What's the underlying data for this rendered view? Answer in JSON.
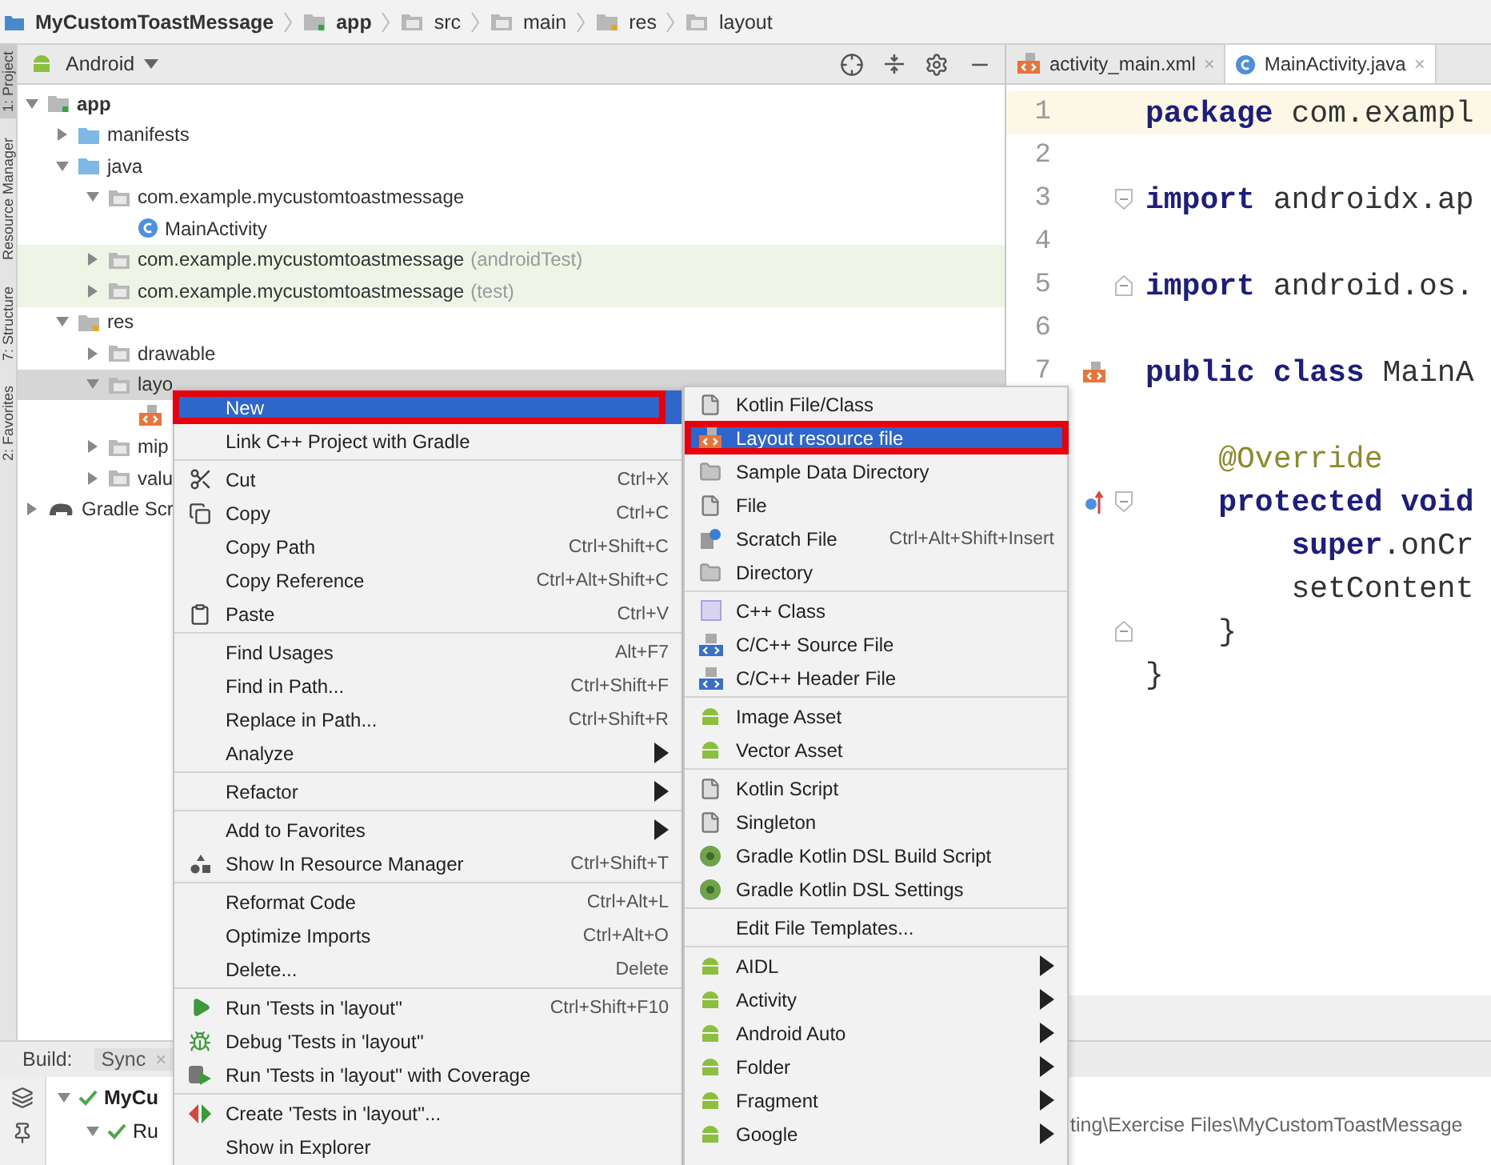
{
  "breadcrumb": [
    {
      "label": "MyCustomToastMessage",
      "bold": true,
      "kind": "project"
    },
    {
      "label": "app",
      "bold": true,
      "kind": "module"
    },
    {
      "label": "src",
      "bold": false,
      "kind": "folder"
    },
    {
      "label": "main",
      "bold": false,
      "kind": "folder"
    },
    {
      "label": "res",
      "bold": false,
      "kind": "res"
    },
    {
      "label": "layout",
      "bold": false,
      "kind": "folder"
    }
  ],
  "side_tabs": [
    {
      "label": "1: Project",
      "selected": true
    },
    {
      "label": "Resource Manager",
      "selected": false
    },
    {
      "label": "7: Structure",
      "selected": false
    },
    {
      "label": "2: Favorites",
      "selected": false
    }
  ],
  "project": {
    "view": "Android",
    "tree": [
      {
        "label": "app",
        "bold": true,
        "kind": "module",
        "expanded": true,
        "selected": false,
        "tinted": false,
        "children": [
          {
            "label": "manifests",
            "bold": false,
            "kind": "source",
            "expanded": false,
            "selected": false,
            "tinted": false
          },
          {
            "label": "java",
            "bold": false,
            "kind": "source",
            "expanded": true,
            "selected": false,
            "tinted": false,
            "children": [
              {
                "label": "com.example.mycustomtoastmessage",
                "bold": false,
                "kind": "package",
                "expanded": true,
                "selected": false,
                "tinted": false,
                "children": [
                  {
                    "label": "MainActivity",
                    "bold": false,
                    "kind": "class",
                    "selected": false,
                    "tinted": false
                  }
                ]
              },
              {
                "label": "com.example.mycustomtoastmessage",
                "suffix": "(androidTest)",
                "bold": false,
                "kind": "package",
                "expanded": false,
                "selected": false,
                "tinted": true
              },
              {
                "label": "com.example.mycustomtoastmessage",
                "suffix": "(test)",
                "bold": false,
                "kind": "package",
                "expanded": false,
                "selected": false,
                "tinted": true
              }
            ]
          },
          {
            "label": "res",
            "bold": false,
            "kind": "res",
            "expanded": true,
            "selected": false,
            "tinted": false,
            "children": [
              {
                "label": "drawable",
                "bold": false,
                "kind": "package",
                "expanded": false,
                "selected": false,
                "tinted": false
              },
              {
                "label": "layo",
                "bold": false,
                "kind": "package",
                "expanded": true,
                "selected": true,
                "tinted": false,
                "children": [
                  {
                    "kind": "layout",
                    "selected": false,
                    "tinted": false
                  }
                ]
              },
              {
                "label": "mip",
                "bold": false,
                "kind": "package",
                "expanded": false,
                "selected": false,
                "tinted": false
              },
              {
                "label": "valu",
                "bold": false,
                "kind": "package",
                "expanded": false,
                "selected": false,
                "tinted": false
              }
            ]
          }
        ]
      },
      {
        "label": "Gradle Scr",
        "bold": false,
        "kind": "gradle",
        "expanded": false,
        "selected": false,
        "tinted": false
      }
    ]
  },
  "editor": {
    "tabs": [
      {
        "label": "activity_main.xml",
        "kind": "layout",
        "close": "×",
        "selected": false
      },
      {
        "label": "MainActivity.java",
        "kind": "class",
        "close": "×",
        "selected": true
      }
    ],
    "lines": [
      {
        "number": "1",
        "current": true,
        "kind": "plain",
        "fold_start": false,
        "fold_end": false,
        "tokens": [
          {
            "text": "package",
            "kind": "keyword"
          },
          {
            "text": " com.exampl",
            "kind": "plain"
          }
        ]
      },
      {
        "number": "2",
        "current": false,
        "kind": "plain",
        "fold_start": false,
        "fold_end": false
      },
      {
        "number": "3",
        "current": false,
        "kind": "plain",
        "fold_start": true,
        "fold_end": false,
        "tokens": [
          {
            "text": "import",
            "kind": "keyword"
          },
          {
            "text": " androidx.ap",
            "kind": "plain"
          }
        ]
      },
      {
        "number": "4",
        "current": false,
        "kind": "plain",
        "fold_start": false,
        "fold_end": false
      },
      {
        "number": "5",
        "current": false,
        "kind": "plain",
        "fold_start": false,
        "fold_end": true,
        "tokens": [
          {
            "text": "import",
            "kind": "keyword"
          },
          {
            "text": " android.os.",
            "kind": "plain"
          }
        ]
      },
      {
        "number": "6",
        "current": false,
        "kind": "plain",
        "fold_start": false,
        "fold_end": false
      },
      {
        "number": "7",
        "current": false,
        "kind": "layout",
        "fold_start": false,
        "fold_end": false,
        "tokens": [
          {
            "text": "public class",
            "kind": "keyword"
          },
          {
            "text": " MainA",
            "kind": "plain"
          }
        ]
      },
      {
        "current": false,
        "kind": "plain",
        "fold_start": false,
        "fold_end": false
      },
      {
        "current": false,
        "kind": "plain",
        "fold_start": false,
        "fold_end": false,
        "tokens": [
          {
            "text": "    @Override",
            "kind": "annotation"
          }
        ]
      },
      {
        "current": false,
        "kind": "override",
        "fold_start": true,
        "fold_end": false,
        "tokens": [
          {
            "text": "    protected void",
            "kind": "keyword"
          }
        ]
      },
      {
        "current": false,
        "kind": "plain",
        "fold_start": false,
        "fold_end": false,
        "tokens": [
          {
            "text": "        super",
            "kind": "keyword"
          },
          {
            "text": ".onCr",
            "kind": "plain"
          }
        ]
      },
      {
        "current": false,
        "kind": "plain",
        "fold_start": false,
        "fold_end": false,
        "tokens": [
          {
            "text": "        setContent",
            "kind": "plain"
          }
        ]
      },
      {
        "current": false,
        "kind": "plain",
        "fold_start": false,
        "fold_end": true,
        "tokens": [
          {
            "text": "    }",
            "kind": "plain"
          }
        ]
      },
      {
        "current": false,
        "kind": "plain",
        "fold_start": false,
        "fold_end": false,
        "tokens": [
          {
            "text": "}",
            "kind": "plain"
          }
        ]
      }
    ]
  },
  "build": {
    "label": "Build:",
    "tabs": [
      {
        "label": "Sync",
        "close": "×",
        "selected": true
      }
    ],
    "rows": [
      {
        "label": "MyCu",
        "bold": true,
        "expanded": true
      },
      {
        "label": "Ru",
        "bold": false,
        "expanded": true
      }
    ],
    "output": "ting\\Exercise Files\\MyCustomToastMessage"
  },
  "menus": [
    {
      "items": [
        {
          "kind": "plain",
          "label": "New",
          "selected": true,
          "annotated": true
        },
        {
          "kind": "plain",
          "label": "Link C++ Project with Gradle",
          "selected": false,
          "annotated": false
        },
        {
          "kind": "separator"
        },
        {
          "kind": "scissors",
          "label": "Cut",
          "shortcut": "Ctrl+X",
          "selected": false,
          "annotated": false
        },
        {
          "kind": "copy",
          "label": "Copy",
          "shortcut": "Ctrl+C",
          "selected": false,
          "annotated": false
        },
        {
          "kind": "plain",
          "label": "Copy Path",
          "shortcut": "Ctrl+Shift+C",
          "selected": false,
          "annotated": false
        },
        {
          "kind": "plain",
          "label": "Copy Reference",
          "shortcut": "Ctrl+Alt+Shift+C",
          "selected": false,
          "annotated": false
        },
        {
          "kind": "paste",
          "label": "Paste",
          "shortcut": "Ctrl+V",
          "selected": false,
          "annotated": false
        },
        {
          "kind": "separator"
        },
        {
          "kind": "plain",
          "label": "Find Usages",
          "shortcut": "Alt+F7",
          "selected": false,
          "annotated": false
        },
        {
          "kind": "plain",
          "label": "Find in Path...",
          "shortcut": "Ctrl+Shift+F",
          "selected": false,
          "annotated": false
        },
        {
          "kind": "plain",
          "label": "Replace in Path...",
          "shortcut": "Ctrl+Shift+R",
          "selected": false,
          "annotated": false
        },
        {
          "kind": "plain",
          "label": "Analyze",
          "selected": false,
          "annotated": false,
          "submenu": true
        },
        {
          "kind": "separator"
        },
        {
          "kind": "plain",
          "label": "Refactor",
          "selected": false,
          "annotated": false,
          "submenu": true
        },
        {
          "kind": "separator"
        },
        {
          "kind": "plain",
          "label": "Add to Favorites",
          "selected": false,
          "annotated": false,
          "submenu": true
        },
        {
          "kind": "resource",
          "label": "Show In Resource Manager",
          "shortcut": "Ctrl+Shift+T",
          "selected": false,
          "annotated": false
        },
        {
          "kind": "separator"
        },
        {
          "kind": "plain",
          "label": "Reformat Code",
          "shortcut": "Ctrl+Alt+L",
          "selected": false,
          "annotated": false
        },
        {
          "kind": "plain",
          "label": "Optimize Imports",
          "shortcut": "Ctrl+Alt+O",
          "selected": false,
          "annotated": false
        },
        {
          "kind": "plain",
          "label": "Delete...",
          "shortcut": "Delete",
          "selected": false,
          "annotated": false
        },
        {
          "kind": "separator"
        },
        {
          "kind": "run",
          "label": "Run 'Tests in 'layout''",
          "shortcut": "Ctrl+Shift+F10",
          "selected": false,
          "annotated": false
        },
        {
          "kind": "debug",
          "label": "Debug 'Tests in 'layout''",
          "selected": false,
          "annotated": false
        },
        {
          "kind": "coverage",
          "label": "Run 'Tests in 'layout'' with Coverage",
          "selected": false,
          "annotated": false
        },
        {
          "kind": "separator"
        },
        {
          "kind": "create",
          "label": "Create 'Tests in 'layout''...",
          "selected": false,
          "annotated": false
        },
        {
          "kind": "plain",
          "label": "Show in Explorer",
          "selected": false,
          "annotated": false
        }
      ]
    },
    {
      "items": [
        {
          "kind": "file",
          "label": "Kotlin File/Class",
          "selected": false,
          "annotated": false
        },
        {
          "kind": "layout",
          "label": "Layout resource file",
          "selected": true,
          "annotated": true
        },
        {
          "kind": "folder",
          "label": "Sample Data Directory",
          "selected": false,
          "annotated": false
        },
        {
          "kind": "file",
          "label": "File",
          "selected": false,
          "annotated": false
        },
        {
          "kind": "scratch",
          "label": "Scratch File",
          "shortcut": "Ctrl+Alt+Shift+Insert",
          "selected": false,
          "annotated": false
        },
        {
          "kind": "folder",
          "label": "Directory",
          "selected": false,
          "annotated": false
        },
        {
          "kind": "separator"
        },
        {
          "kind": "square",
          "label": "C++ Class",
          "selected": false,
          "annotated": false
        },
        {
          "kind": "code",
          "label": "C/C++ Source File",
          "selected": false,
          "annotated": false
        },
        {
          "kind": "code",
          "label": "C/C++ Header File",
          "selected": false,
          "annotated": false
        },
        {
          "kind": "separator"
        },
        {
          "kind": "android",
          "label": "Image Asset",
          "selected": false,
          "annotated": false
        },
        {
          "kind": "android",
          "label": "Vector Asset",
          "selected": false,
          "annotated": false
        },
        {
          "kind": "separator"
        },
        {
          "kind": "file",
          "label": "Kotlin Script",
          "selected": false,
          "annotated": false
        },
        {
          "kind": "file",
          "label": "Singleton",
          "selected": false,
          "annotated": false
        },
        {
          "kind": "gradle",
          "label": "Gradle Kotlin DSL Build Script",
          "selected": false,
          "annotated": false
        },
        {
          "kind": "gradle",
          "label": "Gradle Kotlin DSL Settings",
          "selected": false,
          "annotated": false
        },
        {
          "kind": "separator"
        },
        {
          "kind": "plain",
          "label": "Edit File Templates...",
          "selected": false,
          "annotated": false
        },
        {
          "kind": "separator"
        },
        {
          "kind": "android",
          "label": "AIDL",
          "selected": false,
          "annotated": false,
          "submenu": true
        },
        {
          "kind": "android",
          "label": "Activity",
          "selected": false,
          "annotated": false,
          "submenu": true
        },
        {
          "kind": "android",
          "label": "Android Auto",
          "selected": false,
          "annotated": false,
          "submenu": true
        },
        {
          "kind": "android",
          "label": "Folder",
          "selected": false,
          "annotated": false,
          "submenu": true
        },
        {
          "kind": "android",
          "label": "Fragment",
          "selected": false,
          "annotated": false,
          "submenu": true
        },
        {
          "kind": "android",
          "label": "Google",
          "selected": false,
          "annotated": false,
          "submenu": true
        }
      ]
    }
  ]
}
